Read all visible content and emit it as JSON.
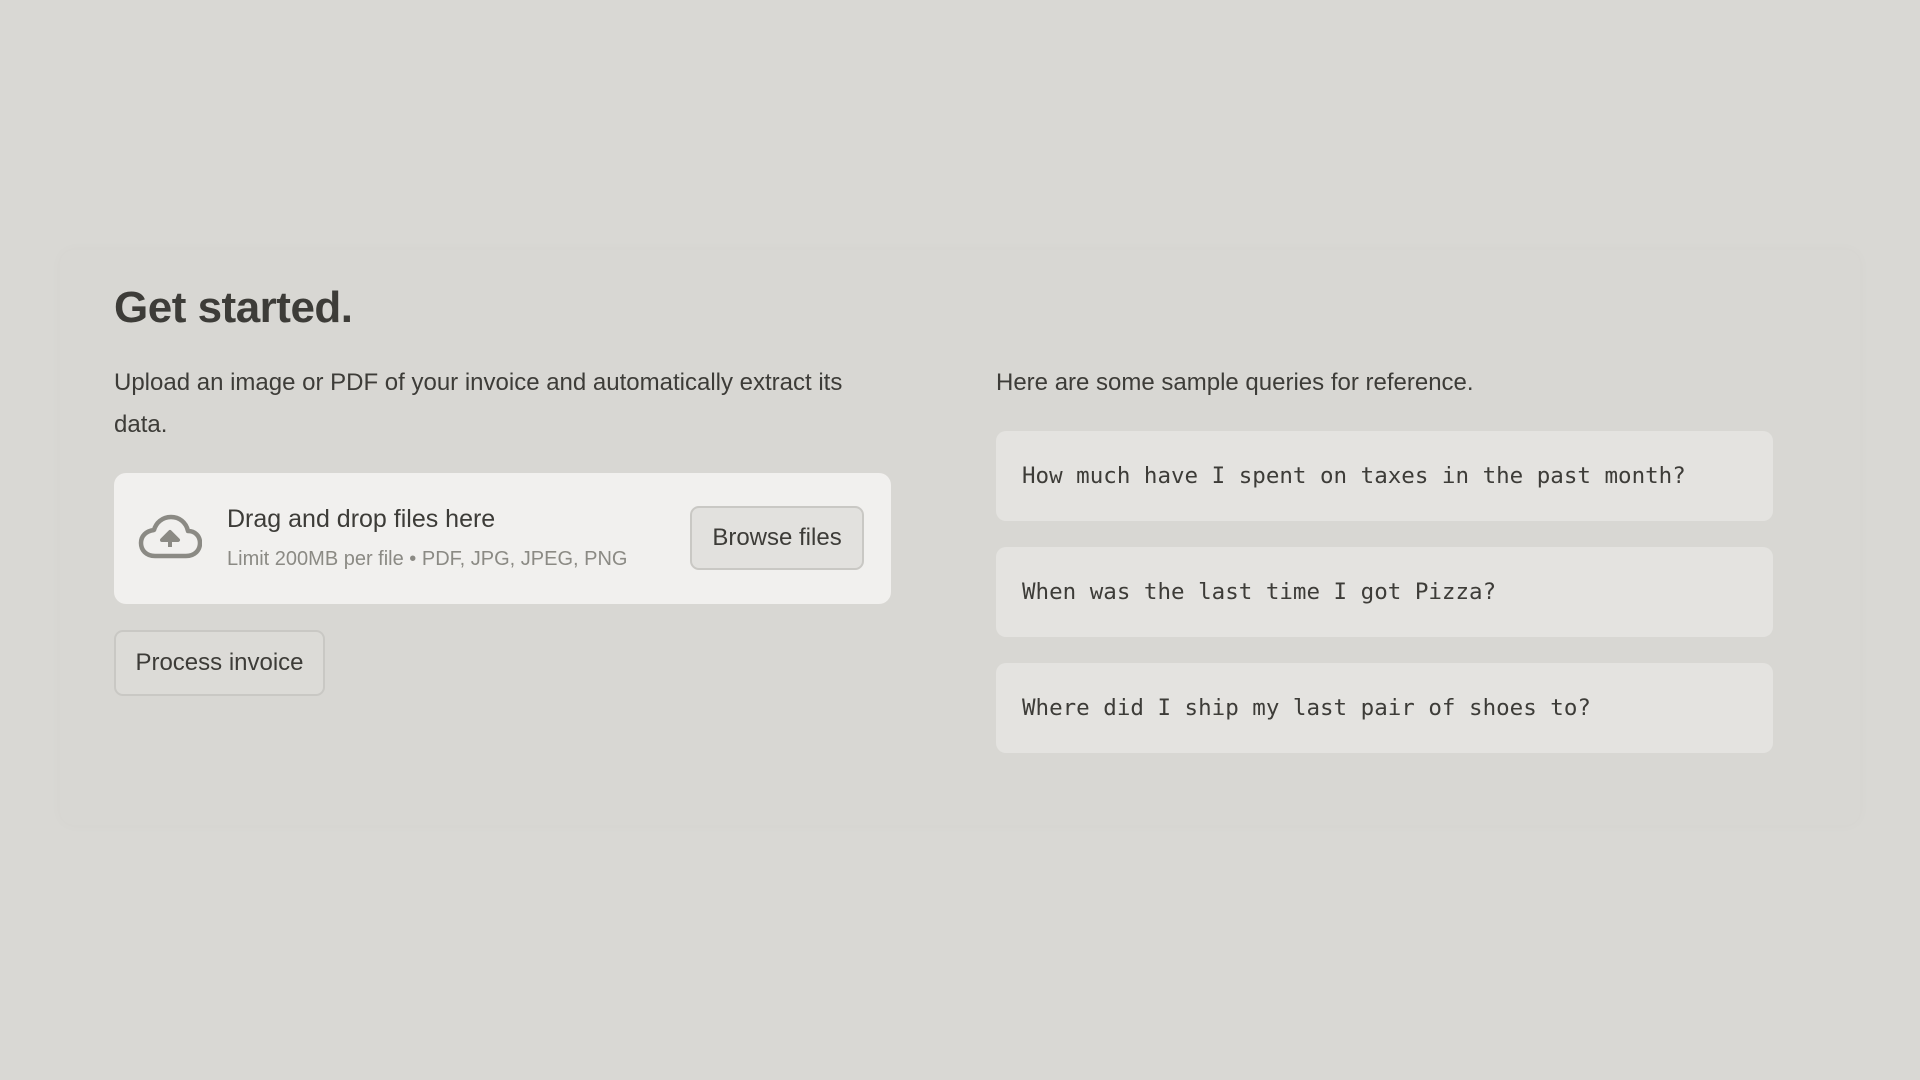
{
  "main": {
    "title": "Get started.",
    "description": "Upload an image or PDF of your invoice and automatically extract its data.",
    "uploader": {
      "icon": "cloud-upload-icon",
      "title": "Drag and drop files here",
      "hint": "Limit 200MB per file • PDF, JPG, JPEG, PNG",
      "browse_label": "Browse files"
    },
    "process_label": "Process invoice"
  },
  "queries": {
    "intro": "Here are some sample queries for reference.",
    "items": [
      "How much have I spent on taxes in the past month?",
      "When was the last time I got Pizza?",
      "Where did I ship my last pair of shoes to?"
    ]
  },
  "colors": {
    "background": "#d9d8d4",
    "uploader_background": "#f1f0ee",
    "query_card_background": "#e4e3e0",
    "text": "#3d3c38",
    "muted_text": "#8b8a84"
  }
}
